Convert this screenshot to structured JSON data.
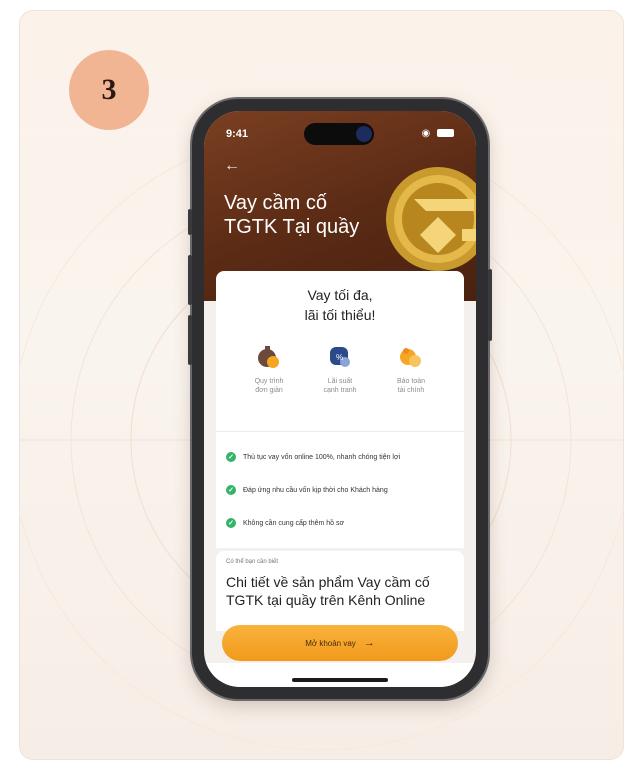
{
  "step_number": "3",
  "status_bar": {
    "time": "9:41",
    "wifi": "wifi-icon",
    "battery": "battery-icon"
  },
  "hero": {
    "back_icon": "back-arrow-icon",
    "title": "Vay cầm cố TGTK Tại quầy",
    "coin_icon": "gold-coin-icon"
  },
  "headline": "Vay tối đa,\nlãi tối thiểu!",
  "features": [
    {
      "label": "Quy trình\nđơn giản",
      "icon": "simple-process-icon"
    },
    {
      "label": "Lãi suất\ncạnh tranh",
      "icon": "competitive-rate-icon"
    },
    {
      "label": "Bảo toàn\ntài chính",
      "icon": "financial-safety-icon"
    }
  ],
  "benefits": [
    "Thủ tục vay vốn online 100%, nhanh chóng tiện lợi",
    "Đáp ứng nhu cầu vốn kịp thời cho Khách hàng",
    "Không cần cung cấp thêm hồ sơ"
  ],
  "info": {
    "caption": "Có thể bạn cần biết",
    "title": "Chi tiết về sản phẩm Vay cầm cố TGTK tại quầy trên Kênh Online"
  },
  "cta": {
    "label": "Mở khoản vay",
    "arrow": "→"
  },
  "colors": {
    "accent": "#f5a623",
    "hero_bg": "#5a2a14",
    "success": "#34b36b",
    "badge": "#f2b594"
  }
}
